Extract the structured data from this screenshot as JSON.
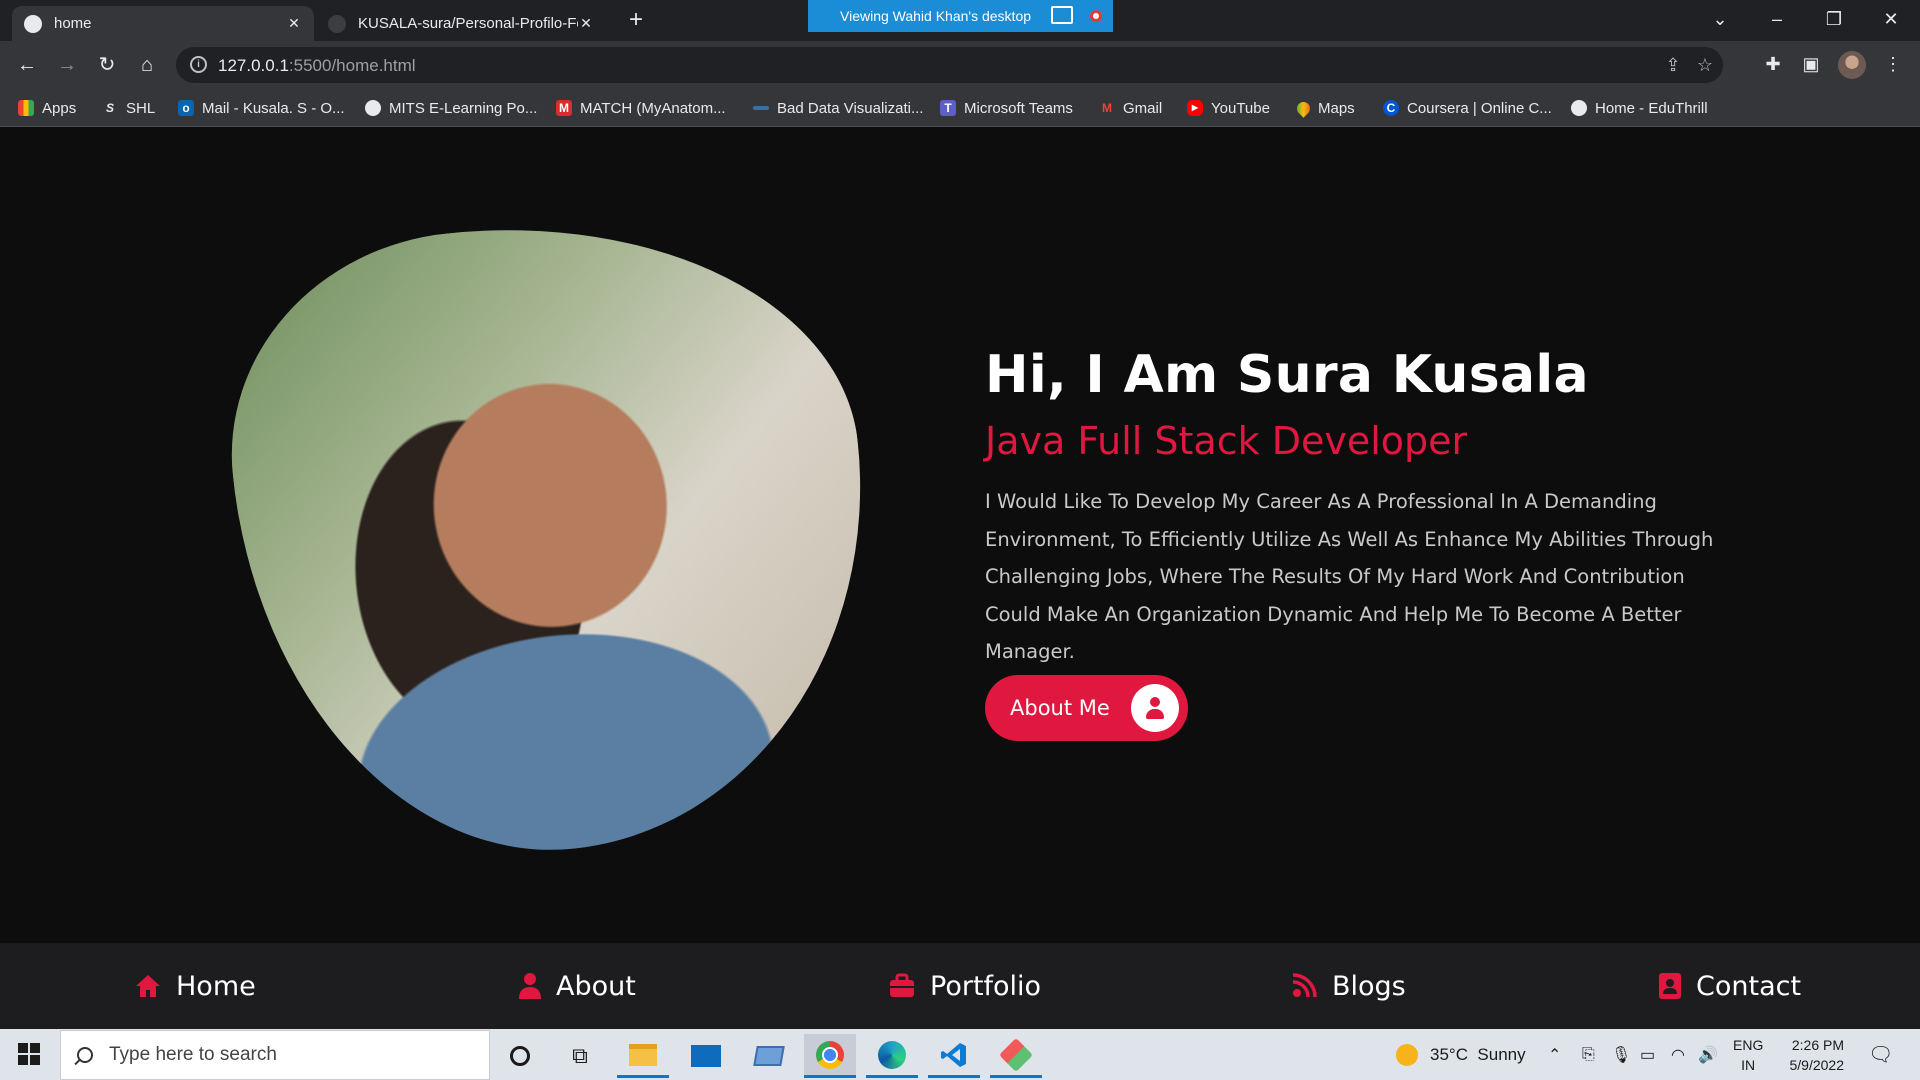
{
  "browser": {
    "tabs": [
      {
        "title": "home",
        "active": true
      },
      {
        "title": "KUSALA-sura/Personal-Profilo-Fo",
        "active": false
      }
    ],
    "screen_share_text": "Viewing Wahid Khan's desktop",
    "url_host": "127.0.0.1",
    "url_rest": ":5500/home.html",
    "bookmarks": [
      "Apps",
      "SHL",
      "Mail - Kusala. S - O...",
      "MITS E-Learning Po...",
      "MATCH (MyAnatom...",
      "Bad Data Visualizati...",
      "Microsoft Teams",
      "Gmail",
      "YouTube",
      "Maps",
      "Coursera | Online C...",
      "Home - EduThrill"
    ]
  },
  "hero": {
    "title": "Hi, I Am Sura Kusala",
    "subtitle": "Java Full Stack Developer",
    "description": "I Would Like To Develop My Career As A Professional In A Demanding Environment, To Efficiently Utilize As Well As Enhance My Abilities Through Challenging Jobs, Where The Results Of My Hard Work And Contribution Could Make An Organization Dynamic And Help Me To Become A Better Manager.",
    "button_label": "About Me"
  },
  "nav": {
    "items": [
      "Home",
      "About",
      "Portfolio",
      "Blogs",
      "Contact"
    ]
  },
  "colors": {
    "accent": "#e0173f",
    "page_bg": "#0d0d0e",
    "nav_bg": "#1d1d1f"
  },
  "taskbar": {
    "search_placeholder": "Type here to search",
    "weather": "35°C  Sunny",
    "lang_top": "ENG",
    "lang_bottom": "IN",
    "time": "2:26 PM",
    "date": "5/9/2022"
  }
}
